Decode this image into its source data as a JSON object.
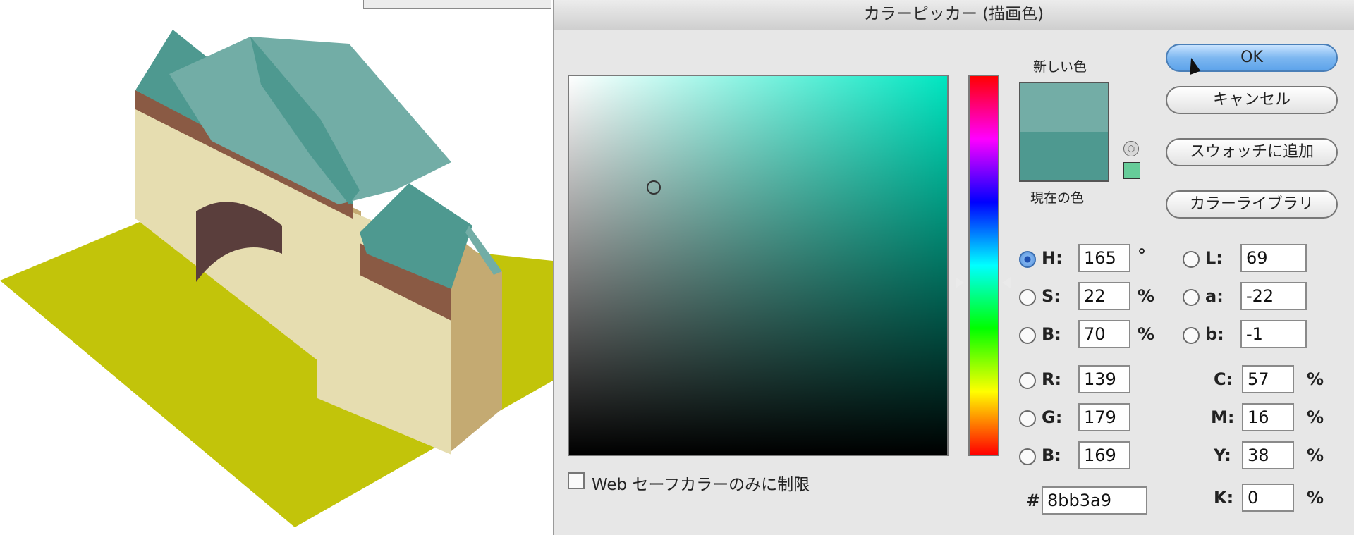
{
  "dialog": {
    "title": "カラーピッカー (描画色)",
    "new_color_label": "新しい色",
    "current_color_label": "現在の色",
    "new_color": "#73ada6",
    "current_color": "#4e9990",
    "websafe_swatch_color": "#66cc99",
    "buttons": {
      "ok": "OK",
      "cancel": "キャンセル",
      "add_swatch": "スウォッチに追加",
      "color_library": "カラーライブラリ"
    },
    "hsb": {
      "h_label": "H:",
      "h_value": "165",
      "h_unit": "°",
      "s_label": "S:",
      "s_value": "22",
      "s_unit": "%",
      "b_label": "B:",
      "b_value": "70",
      "b_unit": "%"
    },
    "rgb": {
      "r_label": "R:",
      "r_value": "139",
      "g_label": "G:",
      "g_value": "179",
      "b_label": "B:",
      "b_value": "169"
    },
    "lab": {
      "l_label": "L:",
      "l_value": "69",
      "a_label": "a:",
      "a_value": "-22",
      "b_label": "b:",
      "b_value": "-1"
    },
    "cmyk": {
      "c_label": "C:",
      "c_value": "57",
      "m_label": "M:",
      "m_value": "16",
      "y_label": "Y:",
      "y_value": "38",
      "k_label": "K:",
      "k_value": "0",
      "unit": "%"
    },
    "hex_label": "#",
    "hex_value": "8bb3a9",
    "websafe_only_label": "Web セーフカラーのみに制限",
    "selected_mode": "H"
  },
  "artwork": {
    "ground_color": "#c2c40a",
    "wall_color": "#e6ddb0",
    "wall_shadow_color": "#c4aa72",
    "band_color": "#8a5a44",
    "roof_light_color": "#72ada6",
    "roof_dark_color": "#4e9990",
    "arch_color": "#5a3e3c"
  }
}
